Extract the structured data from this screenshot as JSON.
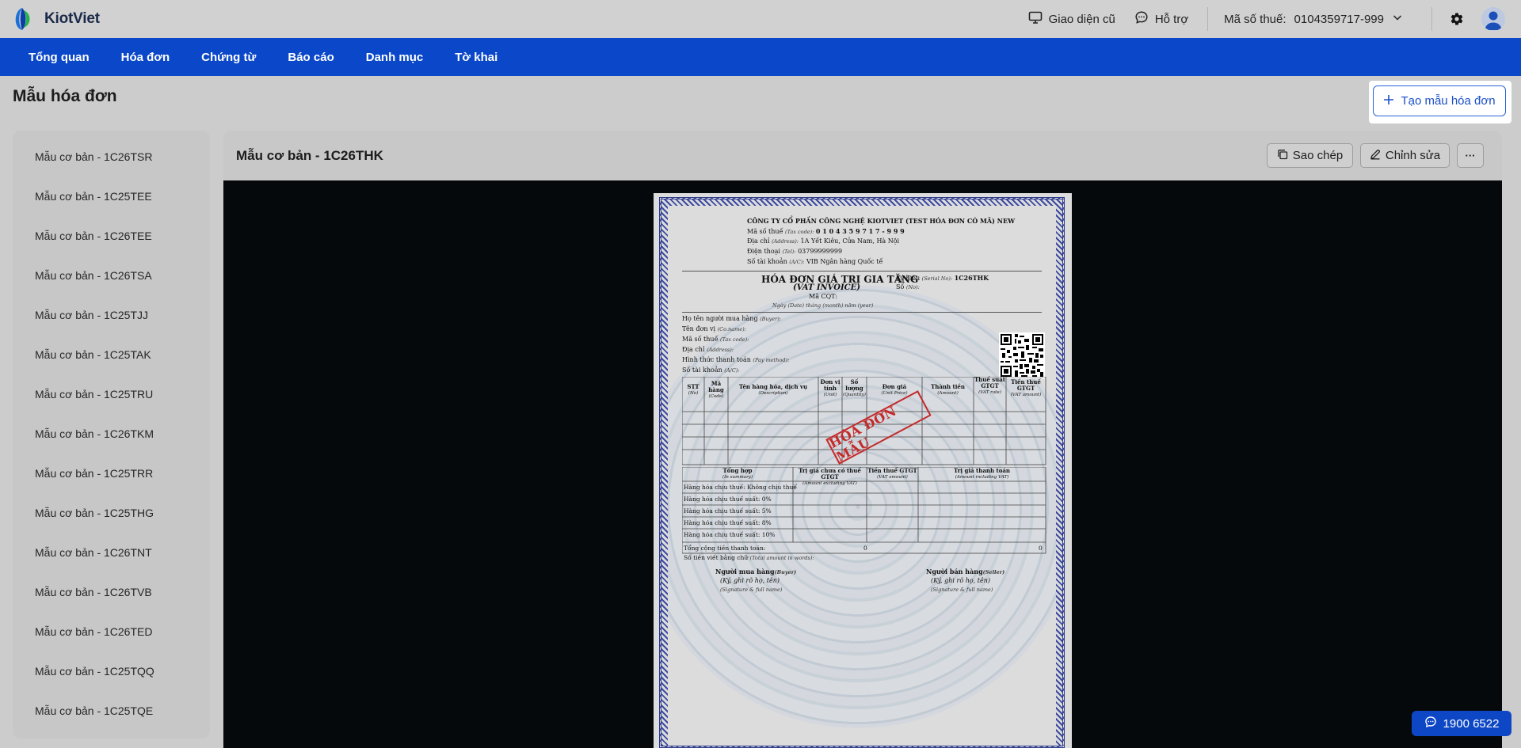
{
  "app": {
    "brand": "KiotViet",
    "accent": "#0a47c9"
  },
  "header": {
    "old_ui_label": "Giao diện cũ",
    "support_label": "Hỗ trợ",
    "tax_label": "Mã số thuế:",
    "tax_value": "0104359717-999"
  },
  "nav": [
    "Tổng quan",
    "Hóa đơn",
    "Chứng từ",
    "Báo cáo",
    "Danh mục",
    "Tờ khai"
  ],
  "page": {
    "title": "Mẫu hóa đơn",
    "create_label": "Tạo mẫu hóa đơn"
  },
  "sidebar": {
    "items": [
      "Mẫu cơ bản - 1C26TSR",
      "Mẫu cơ bản - 1C25TEE",
      "Mẫu cơ bản - 1C26TEE",
      "Mẫu cơ bản - 1C26TSA",
      "Mẫu cơ bản - 1C25TJJ",
      "Mẫu cơ bản - 1C25TAK",
      "Mẫu cơ bản - 1C25TRU",
      "Mẫu cơ bản - 1C26TKM",
      "Mẫu cơ bản - 1C25TRR",
      "Mẫu cơ bản - 1C25THG",
      "Mẫu cơ bản - 1C26TNT",
      "Mẫu cơ bản - 1C26TVB",
      "Mẫu cơ bản - 1C26TED",
      "Mẫu cơ bản - 1C25TQQ",
      "Mẫu cơ bản - 1C25TQE"
    ]
  },
  "main": {
    "title": "Mẫu cơ bản - 1C26THK",
    "copy_label": "Sao chép",
    "edit_label": "Chỉnh sửa",
    "more_label": "···"
  },
  "invoice": {
    "company": "CÔNG TY CỔ PHẦN CÔNG NGHỆ KIOTVIET (TEST HÓA ĐƠN CÓ MÃ) NEW",
    "tax_line_label": "Mã số thuế",
    "tax_line_sub": "(Tax code):",
    "tax_line_value": "0 1 0 4 3 5 9 7 1 7 - 9 9 9",
    "address_label": "Địa chỉ",
    "address_sub": "(Address):",
    "address_value": "1A Yết Kiêu, Cửa Nam, Hà Nội",
    "phone_label": "Điện thoại",
    "phone_sub": "(Tel):",
    "phone_value": "03799999999",
    "account_label": "Số tài khoản",
    "account_sub": "(A/C):",
    "account_value": "VIB Ngân hàng Quốc tế",
    "title": "HÓA ĐƠN GIÁ TRỊ GIA TĂNG",
    "subtitle": "(VAT INVOICE)",
    "serial_label": "Ký hiệu",
    "serial_sub": "(Serial No):",
    "serial_value": "1C26THK",
    "no_label": "Số",
    "no_sub": "(No):",
    "cqt_label": "Mã CQT:",
    "date_line": "Ngày (Date)  tháng (month)  năm (year)",
    "buyer_fields": [
      [
        "Họ tên người mua hàng",
        "(Buyer):"
      ],
      [
        "Tên đơn vị",
        "(Co.name):"
      ],
      [
        "Mã số thuế",
        "(Tax code):"
      ],
      [
        "Địa chỉ",
        "(Address):"
      ],
      [
        "Hình thức thanh toán",
        "(Pay method):"
      ],
      [
        "Số tài khoản",
        "(A/C):"
      ]
    ],
    "table_headers": [
      [
        "STT",
        "(No)"
      ],
      [
        "Mã hàng",
        "(Code)"
      ],
      [
        "Tên hàng hóa, dịch vụ",
        "(Description)"
      ],
      [
        "Đơn vị tính",
        "(Unit)"
      ],
      [
        "Số lượng",
        "(Quantity)"
      ],
      [
        "Đơn giá",
        "(Unit Price)"
      ],
      [
        "Thành tiền",
        "(Amount)"
      ],
      [
        "Thuế suất GTGT",
        "(VAT rate)"
      ],
      [
        "Tiền thuế GTGT",
        "(VAT amount)"
      ]
    ],
    "stamp": "HÓA ĐƠN MẪU",
    "summary_headers": [
      [
        "Tổng hợp",
        "(In summary)"
      ],
      [
        "Trị giá chưa có thuế GTGT",
        "(Amount excluding VAT)"
      ],
      [
        "Tiền thuế GTGT",
        "(VAT amount)"
      ],
      [
        "Trị giá thanh toán",
        "(Amount including VAT)"
      ]
    ],
    "summary_rows": [
      "Hàng hóa chịu thuế: Không chịu thuế",
      "Hàng hóa chịu thuế suất: 0%",
      "Hàng hóa chịu thuế suất: 5%",
      "Hàng hóa chịu thuế suất: 8%",
      "Hàng hóa chịu thuế suất: 10%"
    ],
    "total_label": "Tổng cộng tiền thanh toán:",
    "total_value_1": "0",
    "total_value_2": "0",
    "words_label": "Số tiền viết bằng chữ",
    "words_sub": "(Total amount in words):",
    "buyer_sign": "Người mua hàng",
    "buyer_sign_en": "(Buyer)",
    "seller_sign": "Người bán hàng",
    "seller_sign_en": "(Seller)",
    "sign_hint": "(Ký, ghi rõ họ, tên)",
    "sign_hint_en": "(Signature & full name)"
  },
  "hotline": "1900 6522"
}
